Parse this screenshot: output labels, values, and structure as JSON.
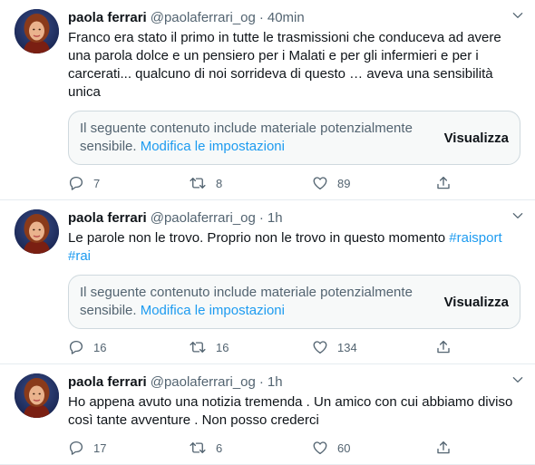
{
  "tweets": [
    {
      "name": "paola ferrari",
      "handle": "@paolaferrari_og",
      "separator": "·",
      "time": "40min",
      "text": "Franco era stato il primo in tutte le trasmissioni che conduceva ad avere una parola dolce e un pensiero per i Malati e per gli infermieri e per i carcerati... qualcuno di noi sorrideva di questo … aveva una sensibilità unica",
      "hashtags": [],
      "sensitive_notice": {
        "text": "Il seguente contenuto include materiale potenzialmente sensibile.",
        "link": "Modifica le impostazioni",
        "button": "Visualizza"
      },
      "replies": "7",
      "retweets": "8",
      "likes": "89"
    },
    {
      "name": "paola ferrari",
      "handle": "@paolaferrari_og",
      "separator": "·",
      "time": "1h",
      "text": "Le parole non le trovo. Proprio non le trovo in questo momento",
      "hashtags": [
        "#raisport",
        "#rai"
      ],
      "sensitive_notice": {
        "text": "Il seguente contenuto include materiale potenzialmente sensibile.",
        "link": "Modifica le impostazioni",
        "button": "Visualizza"
      },
      "replies": "16",
      "retweets": "16",
      "likes": "134"
    },
    {
      "name": "paola ferrari",
      "handle": "@paolaferrari_og",
      "separator": "·",
      "time": "1h",
      "text": "Ho appena avuto una notizia tremenda . Un amico con cui abbiamo diviso così tante avventure . Non posso crederci",
      "hashtags": [],
      "sensitive_notice": null,
      "replies": "17",
      "retweets": "6",
      "likes": "60"
    }
  ],
  "icons": {
    "more": "chevron-down-icon",
    "reply": "reply-icon",
    "retweet": "retweet-icon",
    "like": "heart-icon",
    "share": "share-icon"
  },
  "colors": {
    "link": "#1d9bf0",
    "secondary_text": "#536471",
    "notice_bg": "#f7f9f9"
  }
}
